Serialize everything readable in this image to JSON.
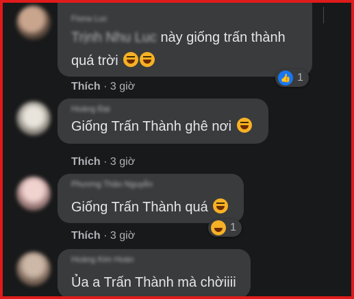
{
  "colors": {
    "frame_border": "#e01b1b",
    "background": "#18191a",
    "bubble": "#3a3b3c",
    "text": "#e4e6eb",
    "muted": "#b0b3b8",
    "like_blue": "#1877f2",
    "emoji_yellow": "#f7b125"
  },
  "comments": [
    {
      "author": "Fiona Luc",
      "mention": "Trịnh Nhu Luc",
      "line1": "này giống trấn thành",
      "line2": "quá trời",
      "emojis": [
        "haha-icon",
        "haha-icon"
      ],
      "like_label": "Thích",
      "time": "· 3 giờ",
      "reaction_count": "1",
      "reaction_icon": "like-icon"
    },
    {
      "author": "Hoàng Đại",
      "line1": "Giống Trấn Thành ghê nơi",
      "emojis": [
        "haha-icon"
      ],
      "like_label": "Thích",
      "time": "· 3 giờ"
    },
    {
      "author": "Phương Thảo Nguyễn",
      "line1": "Giống Trấn Thành quá",
      "emojis": [
        "haha-icon"
      ],
      "like_label": "Thích",
      "time": "· 3 giờ",
      "reaction_count": "1",
      "reaction_icon": "haha-icon"
    },
    {
      "author": "Hoàng Kim Hoàn",
      "line1": "Ủa a Trấn Thành mà chờiiii"
    }
  ]
}
